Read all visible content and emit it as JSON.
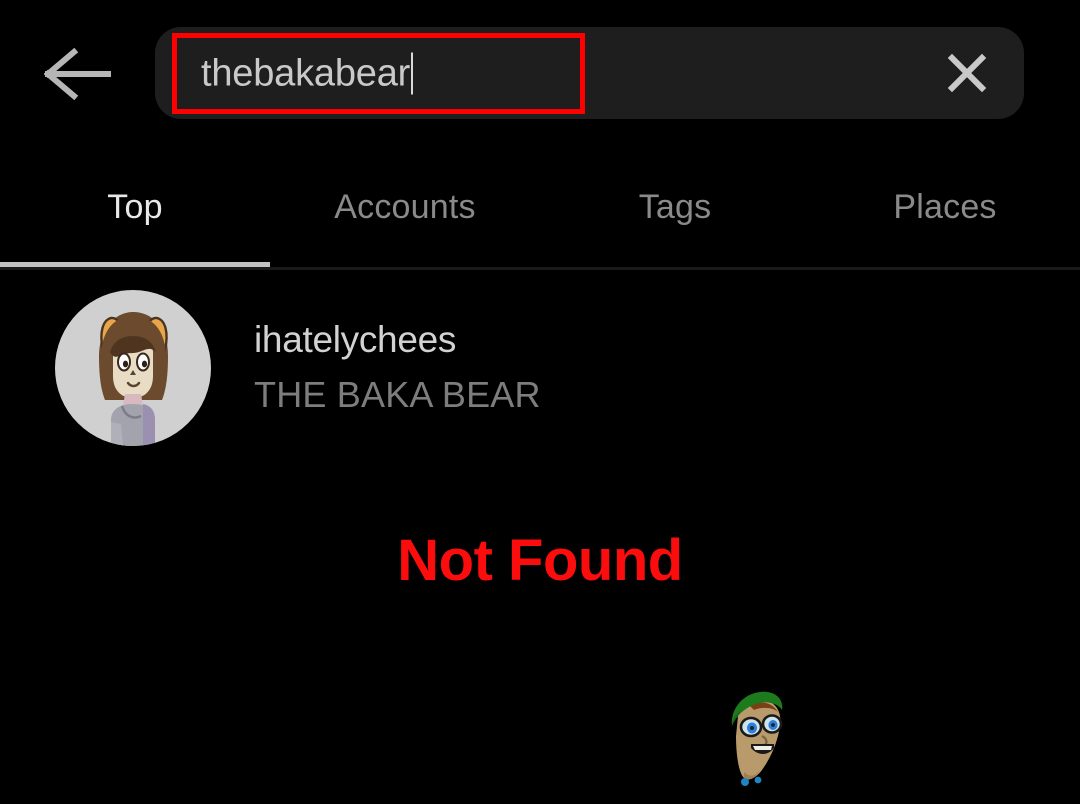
{
  "app": {
    "background_color": "#000000",
    "screen": "instagram-search-results"
  },
  "header": {
    "back_icon": "back-arrow-icon",
    "clear_icon": "close-x-icon",
    "search": {
      "value": "thebakabear",
      "placeholder": "Search",
      "caret_visible": true,
      "highlight_color": "#ff0000",
      "field_background": "#1e1e1e",
      "bar_background": "#1e1e1e"
    }
  },
  "tabs": {
    "active_index": 0,
    "underline_color": "#c2c2c2",
    "items": [
      {
        "label": "Top"
      },
      {
        "label": "Accounts"
      },
      {
        "label": "Tags"
      },
      {
        "label": "Places"
      }
    ]
  },
  "results": [
    {
      "username": "ihatelychees",
      "full_name": "THE BAKA BEAR",
      "avatar": "user-avatar-cartoon-girl",
      "avatar_background": "#cfd0cf"
    }
  ],
  "annotation": {
    "not_found_label": "Not Found",
    "color": "#fc0d0d"
  },
  "cursor": {
    "icon": "cartoon-face-green-cap-cursor"
  }
}
